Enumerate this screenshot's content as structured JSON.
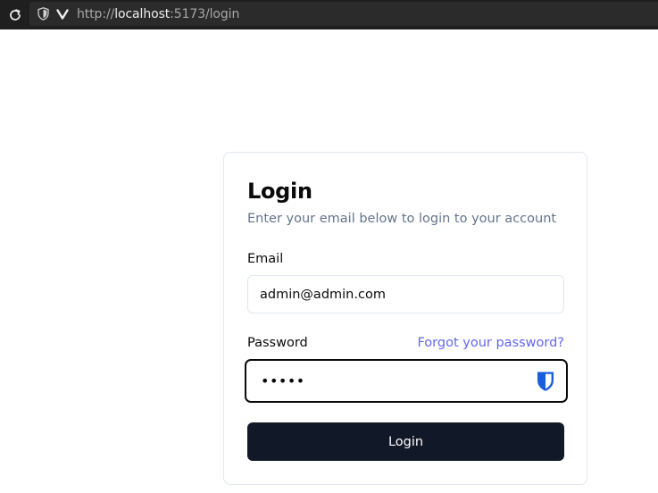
{
  "browser": {
    "url_prefix": "http://",
    "url_host": "localhost",
    "url_rest": ":5173/login",
    "icons": [
      "reload-icon",
      "shield-icon",
      "vivaldi-logo-icon"
    ]
  },
  "login": {
    "title": "Login",
    "subtitle": "Enter your email below to login to your account",
    "email_label": "Email",
    "email_value": "admin@admin.com",
    "password_label": "Password",
    "forgot_link": "Forgot your password?",
    "password_value": "•••••",
    "submit_label": "Login",
    "password_manager_icon": "bitwarden-shield-icon"
  },
  "colors": {
    "button_bg": "#111827",
    "link": "#6366f1",
    "muted_text": "#64748b",
    "bitwarden_blue": "#175ddc"
  }
}
